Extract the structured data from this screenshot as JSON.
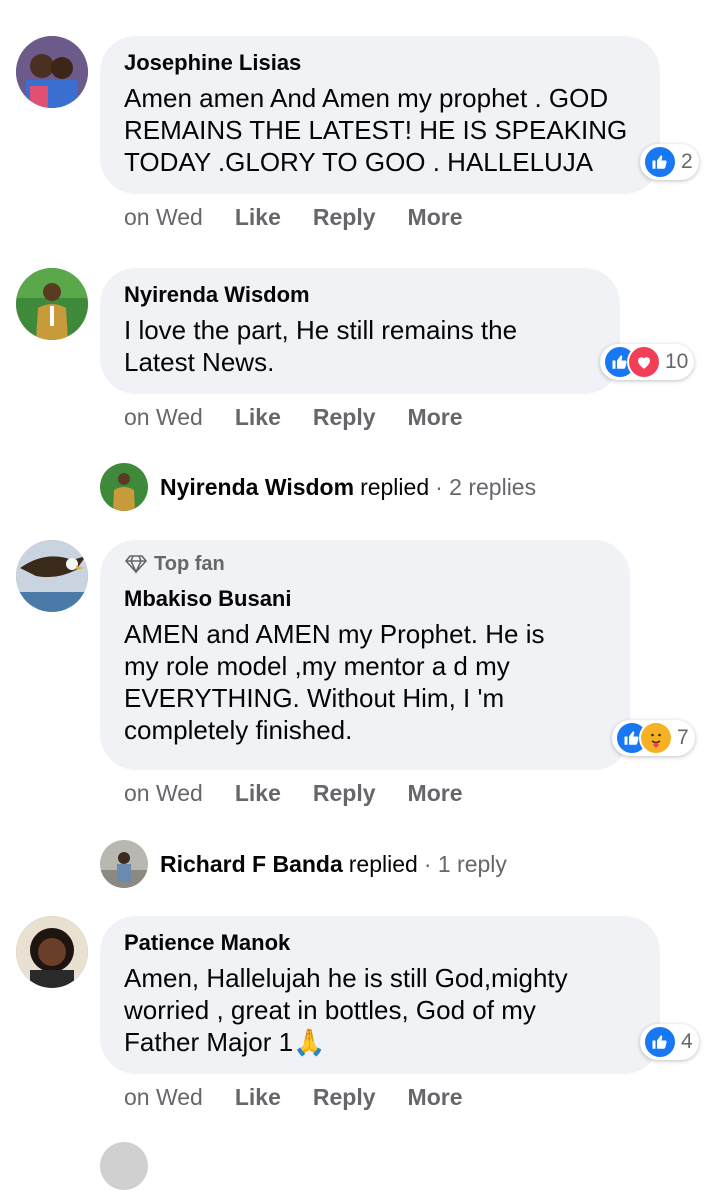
{
  "comments": [
    {
      "name": "Josephine Lisias",
      "text": "Amen amen And Amen my prophet . GOD\nREMAINS THE LATEST! HE IS SPEAKING\nTODAY .GLORY TO GOO . HALLELUJA",
      "time": "on Wed",
      "like": "Like",
      "reply": "Reply",
      "more": "More",
      "reaction_count": "2",
      "reactions": [
        "like-icon"
      ]
    },
    {
      "name": "Nyirenda Wisdom",
      "text": "I love the part, He still remains the\nLatest News.",
      "time": "on Wed",
      "like": "Like",
      "reply": "Reply",
      "more": "More",
      "reaction_count": "10",
      "reactions": [
        "like-icon",
        "love-icon"
      ]
    },
    {
      "badge": "Top fan",
      "name": "Mbakiso Busani",
      "text": "AMEN and AMEN my Prophet. He is\nmy role model ,my mentor a d my\nEVERYTHING. Without Him, I 'm\ncompletely finished.",
      "time": "on Wed",
      "like": "Like",
      "reply": "Reply",
      "more": "More",
      "reaction_count": "7",
      "reactions": [
        "like-icon",
        "care-icon"
      ]
    },
    {
      "name": "Patience Manok",
      "text": "Amen, Hallelujah he is still God,mighty\nworried , great in bottles, God of my\nFather Major 1🙏",
      "time": "on Wed",
      "like": "Like",
      "reply": "Reply",
      "more": "More",
      "reaction_count": "4",
      "reactions": [
        "like-icon"
      ]
    }
  ],
  "replies": [
    {
      "name": "Nyirenda Wisdom",
      "replied": "replied",
      "count": "· 2 replies"
    },
    {
      "name": "Richard F Banda",
      "replied": "replied",
      "count": "· 1 reply"
    }
  ],
  "colors": {
    "bubble": "#f0f2f5",
    "like": "#1877f2",
    "love": "#f33e58",
    "care": "#f7b125",
    "meta": "#65676b"
  }
}
